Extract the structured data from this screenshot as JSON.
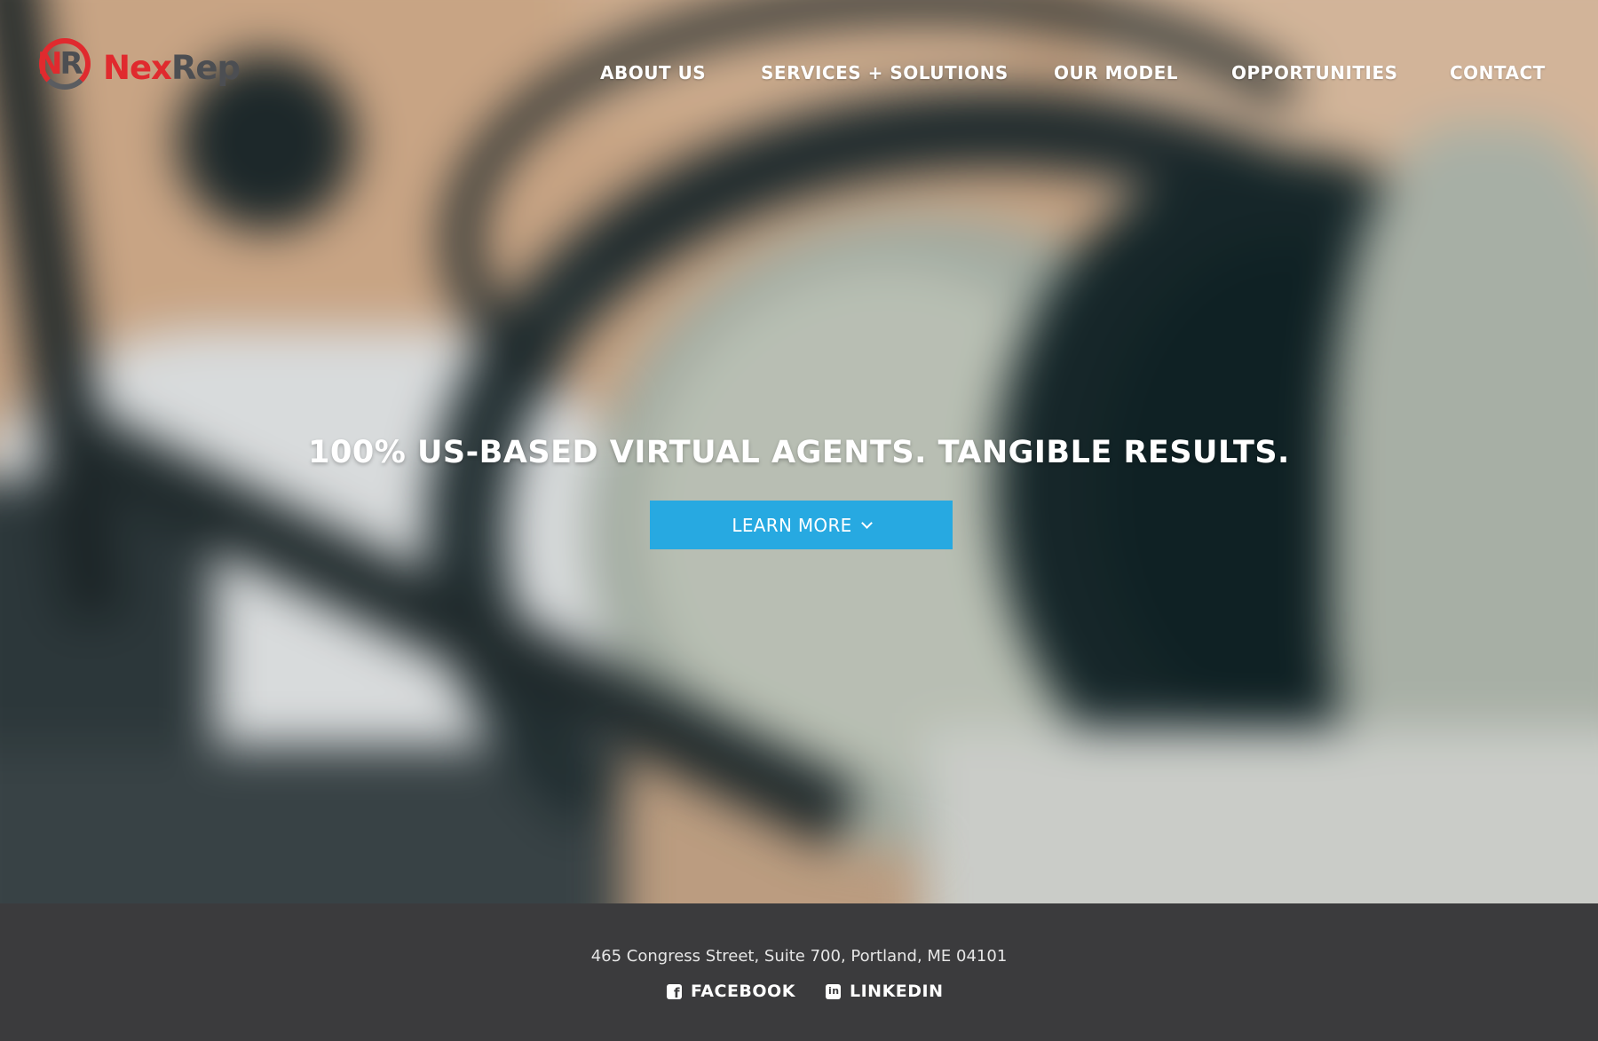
{
  "brand": {
    "logo_mark": "NR",
    "name_part1": "Nex",
    "name_part2": "Rep"
  },
  "nav": {
    "items": [
      {
        "label": "ABOUT US"
      },
      {
        "label": "SERVICES + SOLUTIONS"
      },
      {
        "label": "OUR MODEL"
      },
      {
        "label": "OPPORTUNITIES"
      },
      {
        "label": "CONTACT"
      }
    ]
  },
  "hero": {
    "headline": "100% US-BASED VIRTUAL AGENTS. TANGIBLE RESULTS.",
    "cta_label": "LEARN MORE",
    "cta_icon": "chevron-down-icon"
  },
  "footer": {
    "address": "465 Congress Street, Suite 700, Portland, ME 04101",
    "social": [
      {
        "label": "FACEBOOK",
        "icon": "facebook-icon"
      },
      {
        "label": "LINKEDIN",
        "icon": "linkedin-icon"
      }
    ]
  },
  "colors": {
    "brand_red": "#e02a2e",
    "brand_gray": "#4c4e52",
    "cta_blue": "#27a9e1",
    "footer_bg": "#3b3b3d"
  }
}
